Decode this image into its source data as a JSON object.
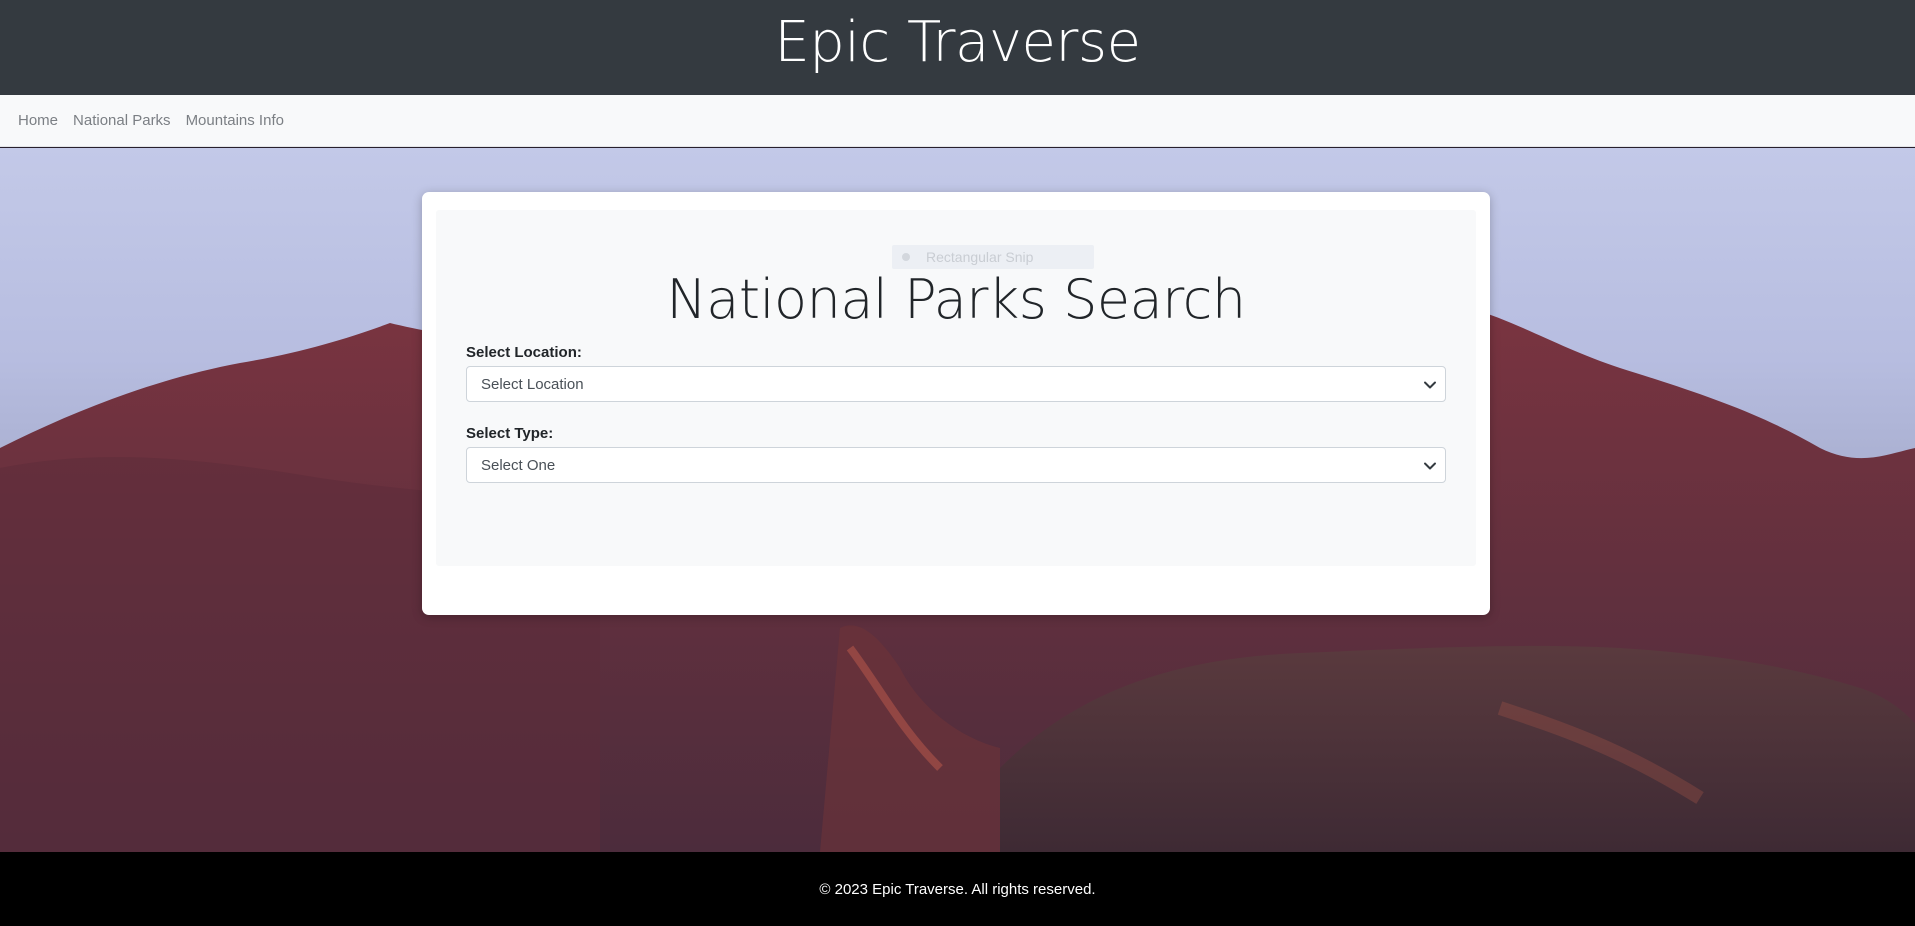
{
  "header": {
    "site_title": "Epic Traverse"
  },
  "nav": {
    "items": [
      {
        "label": "Home"
      },
      {
        "label": "National Parks"
      },
      {
        "label": "Mountains Info"
      }
    ]
  },
  "snip_overlay": {
    "label": "Rectangular Snip"
  },
  "search": {
    "heading": "National Parks Search",
    "location": {
      "label": "Select Location:",
      "selected": "Select Location"
    },
    "type": {
      "label": "Select Type:",
      "selected": "Select One"
    }
  },
  "footer": {
    "copyright": "© 2023 Epic Traverse. All rights reserved."
  },
  "colors": {
    "header_bg": "#343a40",
    "navbar_bg": "#f8f9fa",
    "footer_bg": "#000000",
    "mountain": "#6a2f3a"
  }
}
